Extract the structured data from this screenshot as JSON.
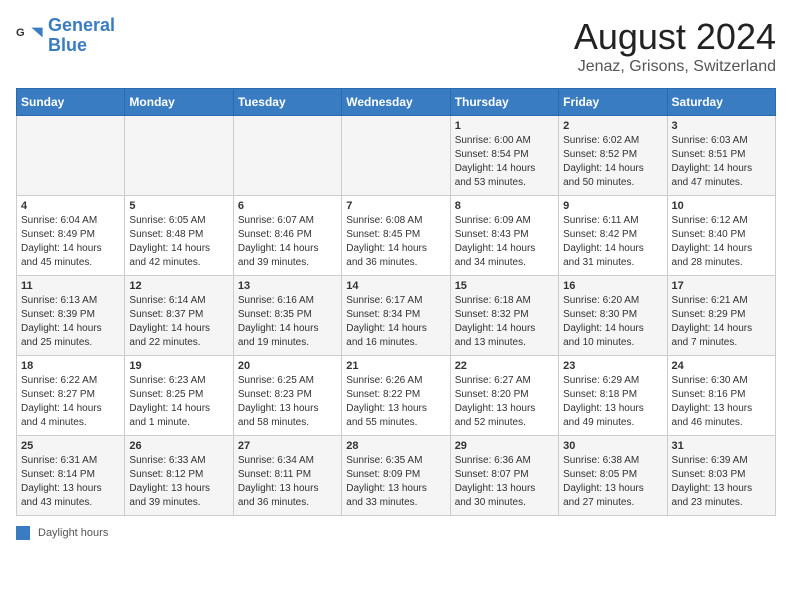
{
  "header": {
    "logo_line1": "General",
    "logo_line2": "Blue",
    "title": "August 2024",
    "subtitle": "Jenaz, Grisons, Switzerland"
  },
  "days_of_week": [
    "Sunday",
    "Monday",
    "Tuesday",
    "Wednesday",
    "Thursday",
    "Friday",
    "Saturday"
  ],
  "footer": {
    "box_label": "Daylight hours"
  },
  "weeks": [
    [
      {
        "day": "",
        "info": ""
      },
      {
        "day": "",
        "info": ""
      },
      {
        "day": "",
        "info": ""
      },
      {
        "day": "",
        "info": ""
      },
      {
        "day": "1",
        "info": "Sunrise: 6:00 AM\nSunset: 8:54 PM\nDaylight: 14 hours\nand 53 minutes."
      },
      {
        "day": "2",
        "info": "Sunrise: 6:02 AM\nSunset: 8:52 PM\nDaylight: 14 hours\nand 50 minutes."
      },
      {
        "day": "3",
        "info": "Sunrise: 6:03 AM\nSunset: 8:51 PM\nDaylight: 14 hours\nand 47 minutes."
      }
    ],
    [
      {
        "day": "4",
        "info": "Sunrise: 6:04 AM\nSunset: 8:49 PM\nDaylight: 14 hours\nand 45 minutes."
      },
      {
        "day": "5",
        "info": "Sunrise: 6:05 AM\nSunset: 8:48 PM\nDaylight: 14 hours\nand 42 minutes."
      },
      {
        "day": "6",
        "info": "Sunrise: 6:07 AM\nSunset: 8:46 PM\nDaylight: 14 hours\nand 39 minutes."
      },
      {
        "day": "7",
        "info": "Sunrise: 6:08 AM\nSunset: 8:45 PM\nDaylight: 14 hours\nand 36 minutes."
      },
      {
        "day": "8",
        "info": "Sunrise: 6:09 AM\nSunset: 8:43 PM\nDaylight: 14 hours\nand 34 minutes."
      },
      {
        "day": "9",
        "info": "Sunrise: 6:11 AM\nSunset: 8:42 PM\nDaylight: 14 hours\nand 31 minutes."
      },
      {
        "day": "10",
        "info": "Sunrise: 6:12 AM\nSunset: 8:40 PM\nDaylight: 14 hours\nand 28 minutes."
      }
    ],
    [
      {
        "day": "11",
        "info": "Sunrise: 6:13 AM\nSunset: 8:39 PM\nDaylight: 14 hours\nand 25 minutes."
      },
      {
        "day": "12",
        "info": "Sunrise: 6:14 AM\nSunset: 8:37 PM\nDaylight: 14 hours\nand 22 minutes."
      },
      {
        "day": "13",
        "info": "Sunrise: 6:16 AM\nSunset: 8:35 PM\nDaylight: 14 hours\nand 19 minutes."
      },
      {
        "day": "14",
        "info": "Sunrise: 6:17 AM\nSunset: 8:34 PM\nDaylight: 14 hours\nand 16 minutes."
      },
      {
        "day": "15",
        "info": "Sunrise: 6:18 AM\nSunset: 8:32 PM\nDaylight: 14 hours\nand 13 minutes."
      },
      {
        "day": "16",
        "info": "Sunrise: 6:20 AM\nSunset: 8:30 PM\nDaylight: 14 hours\nand 10 minutes."
      },
      {
        "day": "17",
        "info": "Sunrise: 6:21 AM\nSunset: 8:29 PM\nDaylight: 14 hours\nand 7 minutes."
      }
    ],
    [
      {
        "day": "18",
        "info": "Sunrise: 6:22 AM\nSunset: 8:27 PM\nDaylight: 14 hours\nand 4 minutes."
      },
      {
        "day": "19",
        "info": "Sunrise: 6:23 AM\nSunset: 8:25 PM\nDaylight: 14 hours\nand 1 minute."
      },
      {
        "day": "20",
        "info": "Sunrise: 6:25 AM\nSunset: 8:23 PM\nDaylight: 13 hours\nand 58 minutes."
      },
      {
        "day": "21",
        "info": "Sunrise: 6:26 AM\nSunset: 8:22 PM\nDaylight: 13 hours\nand 55 minutes."
      },
      {
        "day": "22",
        "info": "Sunrise: 6:27 AM\nSunset: 8:20 PM\nDaylight: 13 hours\nand 52 minutes."
      },
      {
        "day": "23",
        "info": "Sunrise: 6:29 AM\nSunset: 8:18 PM\nDaylight: 13 hours\nand 49 minutes."
      },
      {
        "day": "24",
        "info": "Sunrise: 6:30 AM\nSunset: 8:16 PM\nDaylight: 13 hours\nand 46 minutes."
      }
    ],
    [
      {
        "day": "25",
        "info": "Sunrise: 6:31 AM\nSunset: 8:14 PM\nDaylight: 13 hours\nand 43 minutes."
      },
      {
        "day": "26",
        "info": "Sunrise: 6:33 AM\nSunset: 8:12 PM\nDaylight: 13 hours\nand 39 minutes."
      },
      {
        "day": "27",
        "info": "Sunrise: 6:34 AM\nSunset: 8:11 PM\nDaylight: 13 hours\nand 36 minutes."
      },
      {
        "day": "28",
        "info": "Sunrise: 6:35 AM\nSunset: 8:09 PM\nDaylight: 13 hours\nand 33 minutes."
      },
      {
        "day": "29",
        "info": "Sunrise: 6:36 AM\nSunset: 8:07 PM\nDaylight: 13 hours\nand 30 minutes."
      },
      {
        "day": "30",
        "info": "Sunrise: 6:38 AM\nSunset: 8:05 PM\nDaylight: 13 hours\nand 27 minutes."
      },
      {
        "day": "31",
        "info": "Sunrise: 6:39 AM\nSunset: 8:03 PM\nDaylight: 13 hours\nand 23 minutes."
      }
    ]
  ]
}
